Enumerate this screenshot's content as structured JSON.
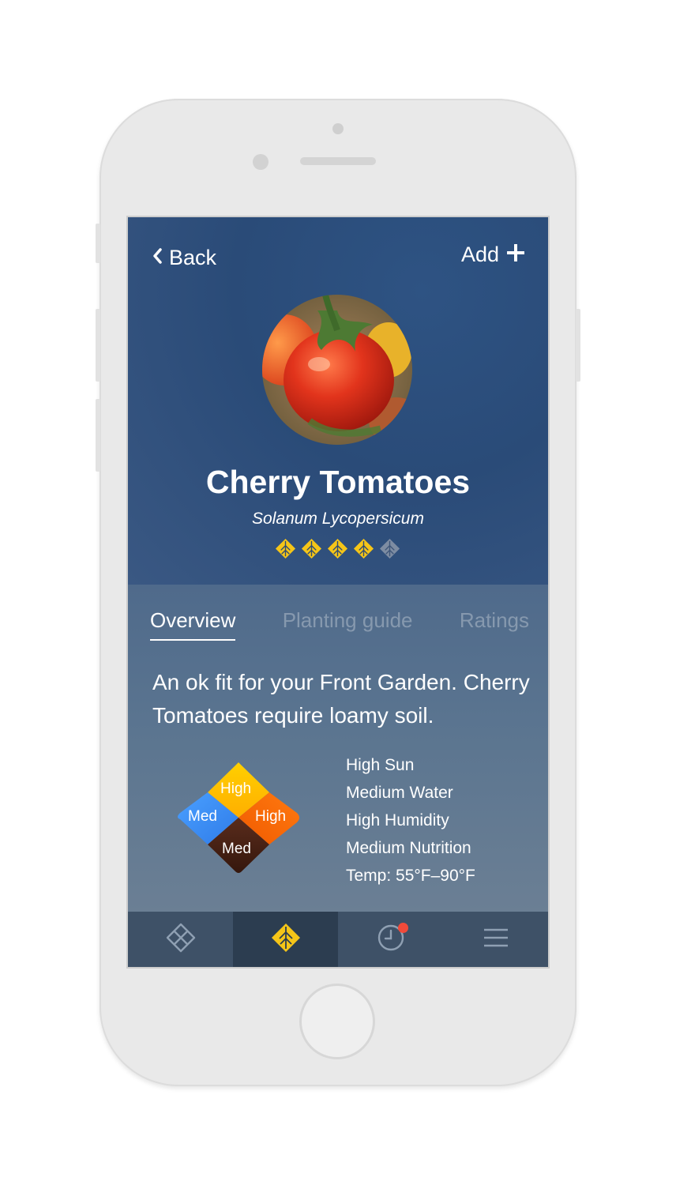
{
  "nav": {
    "back_label": "Back",
    "add_label": "Add"
  },
  "plant": {
    "name": "Cherry Tomatoes",
    "scientific_name": "Solanum Lycopersicum",
    "rating": {
      "value": 4,
      "max": 5
    }
  },
  "tabs": [
    {
      "label": "Overview",
      "active": true
    },
    {
      "label": "Planting guide",
      "active": false
    },
    {
      "label": "Ratings",
      "active": false
    }
  ],
  "description": "An ok fit for your Front Garden. Cherry Tomatoes require loamy soil.",
  "needs_diamond": {
    "top": "High",
    "left": "Med",
    "right": "High",
    "bottom": "Med"
  },
  "stats": [
    "High Sun",
    "Medium Water",
    "High Humidity",
    "Medium Nutrition",
    "Temp: 55°F–90°F"
  ],
  "tabbar": [
    {
      "icon": "garden-grid-icon",
      "active": false
    },
    {
      "icon": "leaf-icon",
      "active": true
    },
    {
      "icon": "clock-icon",
      "active": false,
      "badge": true
    },
    {
      "icon": "menu-icon",
      "active": false
    }
  ],
  "colors": {
    "accent_yellow": "#f5c518",
    "diamond_top": "#ffbf00",
    "diamond_left": "#3d8ef5",
    "diamond_right": "#ff6a00",
    "diamond_bottom": "#4a2417",
    "badge_red": "#f04a3a"
  }
}
